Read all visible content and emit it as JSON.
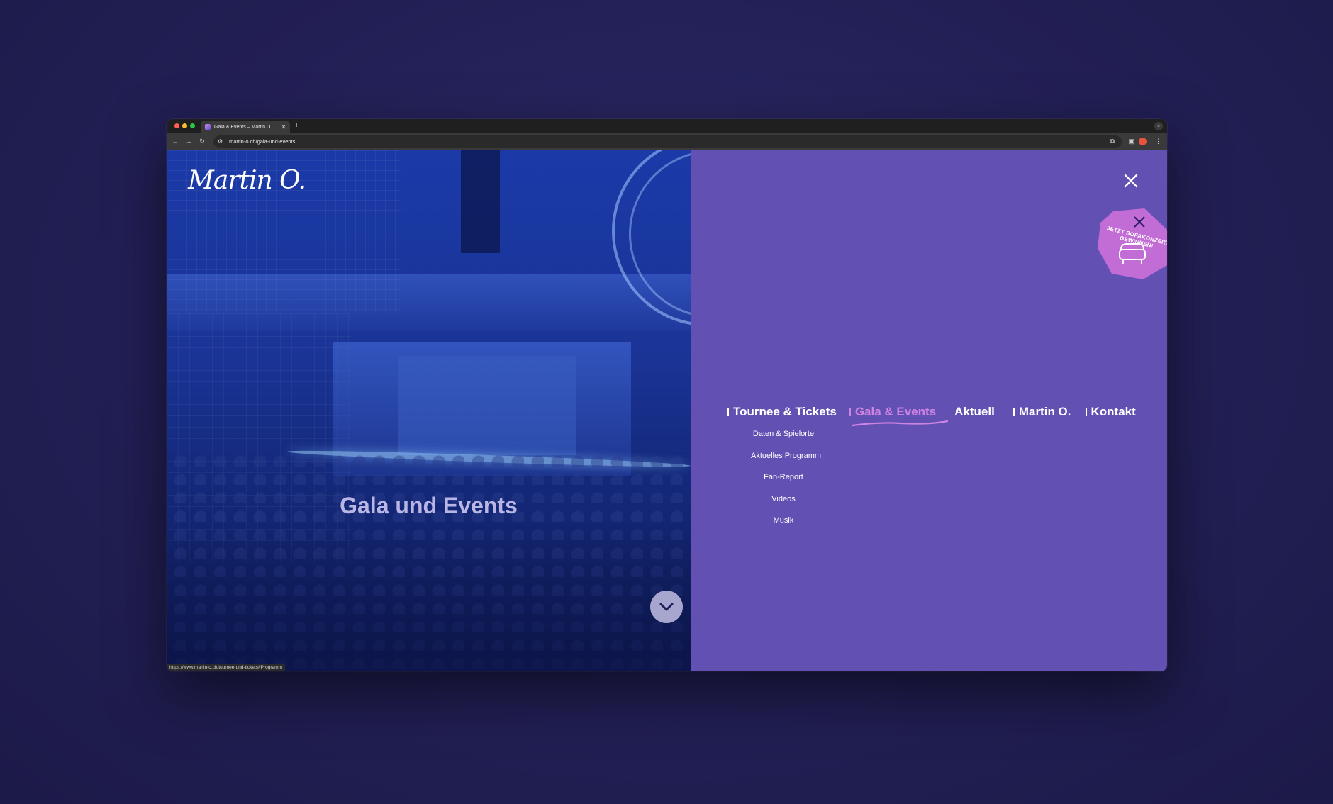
{
  "browser": {
    "tab_title": "Gala & Events – Martin O.",
    "tab_close_icon": "close-icon",
    "new_tab_label": "+",
    "url": "martin-o.ch/gala-und-events",
    "status_url": "https://www.martin-o.ch/tournee-und-tickets#Programm"
  },
  "site": {
    "logo_text": "Martin O.",
    "hero_title": "Gala und Events",
    "badge_text": "JETZT SOFAKONZERT GEWINNEN!",
    "nav": [
      {
        "label": "Tournee & Tickets",
        "active": false
      },
      {
        "label": "Gala & Events",
        "active": true
      },
      {
        "label": "Aktuell",
        "active": false
      },
      {
        "label": "Martin O.",
        "active": false
      },
      {
        "label": "Kontakt",
        "active": false
      }
    ],
    "submenu": [
      "Daten & Spielorte",
      "Aktuelles Programm",
      "Fan-Report",
      "Videos",
      "Musik"
    ]
  },
  "colors": {
    "menu_bg": "#6250b3",
    "active_nav": "#cf84e3",
    "badge": "#c26cd6",
    "hero_overlay": "#1b3aa8"
  }
}
